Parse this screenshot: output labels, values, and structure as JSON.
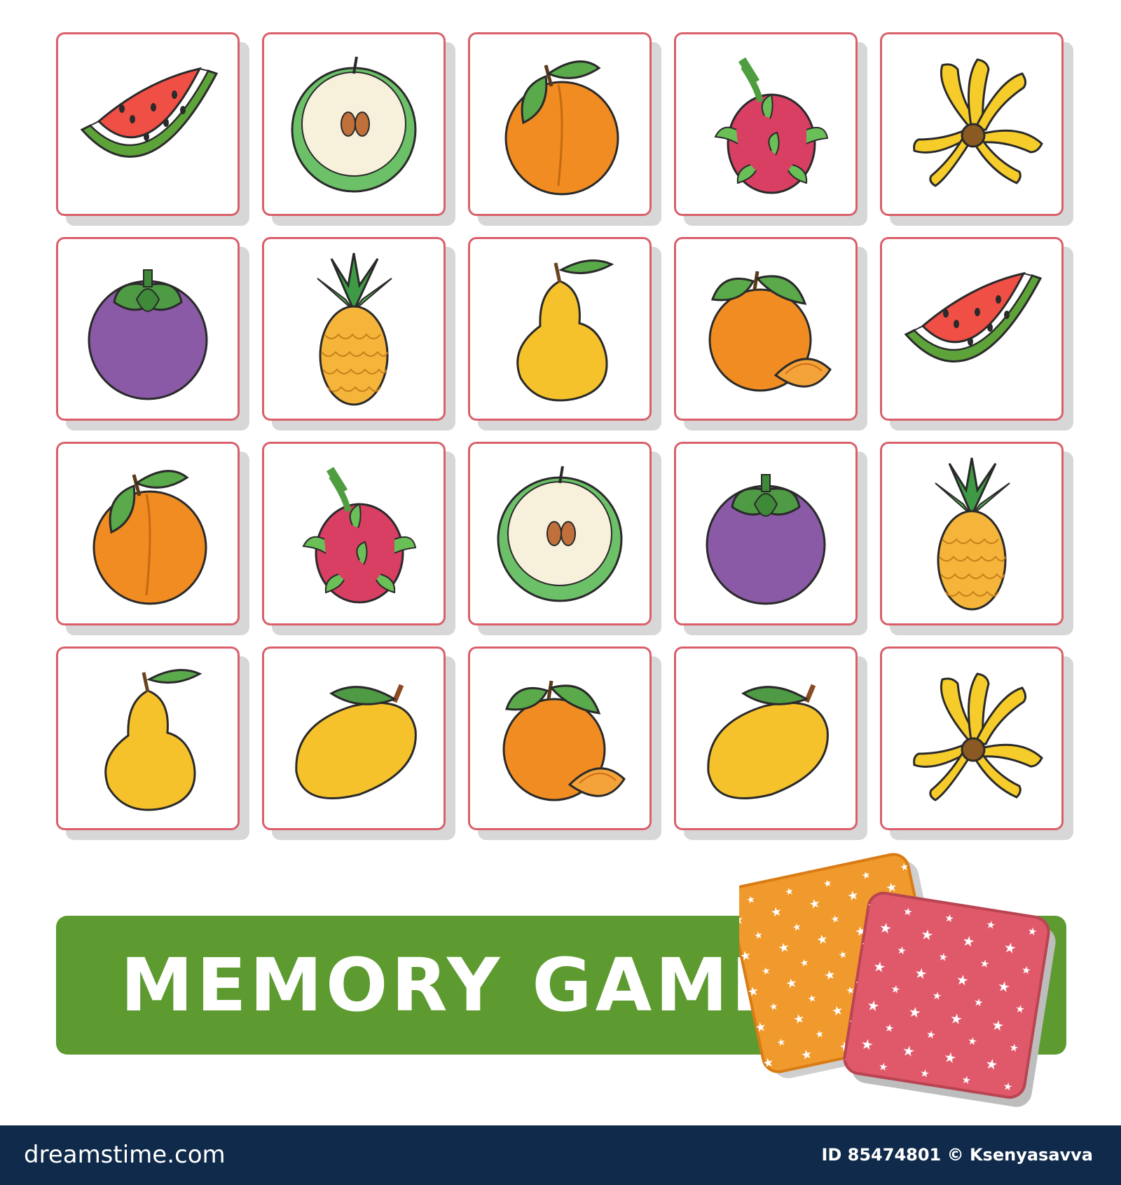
{
  "title": "MEMORY GAME",
  "colors": {
    "card_border": "#d9606a",
    "banner": "#5d9a2f",
    "back_orange": "#f0992c",
    "back_red": "#e0596a",
    "footer": "#0f2a4a"
  },
  "cards": [
    {
      "fruit": "watermelon-icon"
    },
    {
      "fruit": "apple-icon"
    },
    {
      "fruit": "peach-icon"
    },
    {
      "fruit": "dragon-fruit-icon"
    },
    {
      "fruit": "banana-icon"
    },
    {
      "fruit": "mangosteen-icon"
    },
    {
      "fruit": "pineapple-icon"
    },
    {
      "fruit": "pear-icon"
    },
    {
      "fruit": "tangerine-icon"
    },
    {
      "fruit": "watermelon-icon"
    },
    {
      "fruit": "peach-icon"
    },
    {
      "fruit": "dragon-fruit-icon"
    },
    {
      "fruit": "apple-icon"
    },
    {
      "fruit": "mangosteen-icon"
    },
    {
      "fruit": "pineapple-icon"
    },
    {
      "fruit": "pear-icon"
    },
    {
      "fruit": "mango-icon"
    },
    {
      "fruit": "tangerine-icon"
    },
    {
      "fruit": "mango-icon"
    },
    {
      "fruit": "banana-icon"
    }
  ],
  "footer": {
    "brand": "dreamstime.com",
    "id_text": "ID 85474801 © Ksenyasavva"
  }
}
